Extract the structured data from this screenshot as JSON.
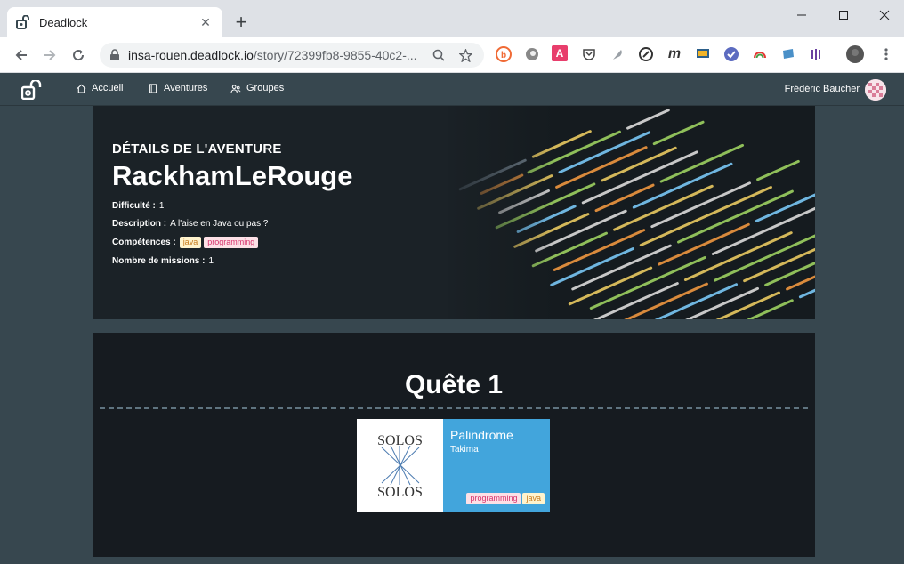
{
  "browser": {
    "tab_title": "Deadlock",
    "url_host": "insa-rouen.deadlock.io",
    "url_path": "/story/72399fb8-9855-40c2-..."
  },
  "appnav": {
    "links": [
      {
        "label": "Accueil",
        "icon": "home-icon"
      },
      {
        "label": "Aventures",
        "icon": "book-icon"
      },
      {
        "label": "Groupes",
        "icon": "group-icon"
      }
    ],
    "user_name": "Frédéric Baucher"
  },
  "hero": {
    "subtitle": "DÉTAILS DE L'AVENTURE",
    "title": "RackhamLeRouge",
    "difficulty_label": "Difficulté :",
    "difficulty_value": "1",
    "description_label": "Description :",
    "description_value": "A l'aise en Java ou pas ?",
    "skills_label": "Compétences :",
    "skills": [
      "java",
      "programming"
    ],
    "missions_label": "Nombre de missions :",
    "missions_value": "1"
  },
  "quest": {
    "title": "Quête 1",
    "mission": {
      "logo_text_top": "SOLOS",
      "logo_text_bottom": "SOLOS",
      "name": "Palindrome",
      "author": "Takima",
      "tags": [
        "programming",
        "java"
      ]
    }
  },
  "colors": {
    "appnav_bg": "#37474f",
    "mission_card": "#42a5dc",
    "tag_java_bg": "#fff3cd",
    "tag_programming_bg": "#fde0e6"
  }
}
